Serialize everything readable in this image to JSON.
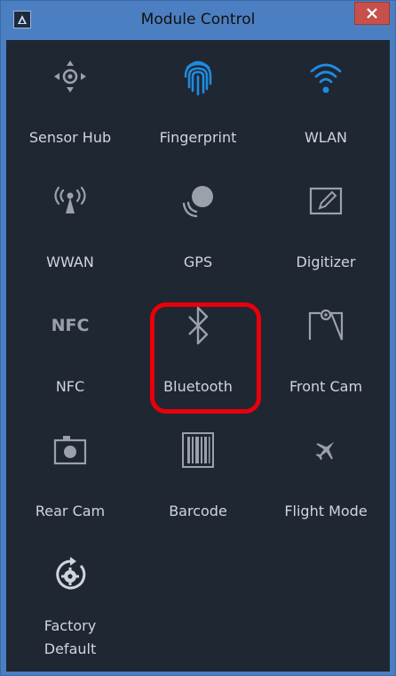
{
  "window": {
    "title": "Module Control",
    "colors": {
      "frame": "#4b7fc1",
      "panel": "#1f2733",
      "icon": "#9aa1aa",
      "accent": "#1e8be0",
      "close": "#c7504a",
      "highlight": "#e8000b"
    }
  },
  "modules": [
    {
      "id": "sensor-hub",
      "label": "Sensor Hub",
      "icon": "gamepad-icon"
    },
    {
      "id": "fingerprint",
      "label": "Fingerprint",
      "icon": "fingerprint-icon"
    },
    {
      "id": "wlan",
      "label": "WLAN",
      "icon": "wifi-icon"
    },
    {
      "id": "wwan",
      "label": "WWAN",
      "icon": "antenna-icon"
    },
    {
      "id": "gps",
      "label": "GPS",
      "icon": "satellite-icon"
    },
    {
      "id": "digitizer",
      "label": "Digitizer",
      "icon": "pen-tablet-icon"
    },
    {
      "id": "nfc",
      "label": "NFC",
      "icon": "nfc-icon",
      "icon_text": "NFC"
    },
    {
      "id": "bluetooth",
      "label": "Bluetooth",
      "icon": "bluetooth-icon"
    },
    {
      "id": "front-cam",
      "label": "Front Cam",
      "icon": "front-camera-icon"
    },
    {
      "id": "rear-cam",
      "label": "Rear Cam",
      "icon": "camera-icon"
    },
    {
      "id": "barcode",
      "label": "Barcode",
      "icon": "barcode-icon"
    },
    {
      "id": "flight-mode",
      "label": "Flight Mode",
      "icon": "airplane-icon"
    },
    {
      "id": "factory-default",
      "label_line1": "Factory",
      "label_line2": "Default",
      "icon": "reset-gear-icon"
    }
  ]
}
